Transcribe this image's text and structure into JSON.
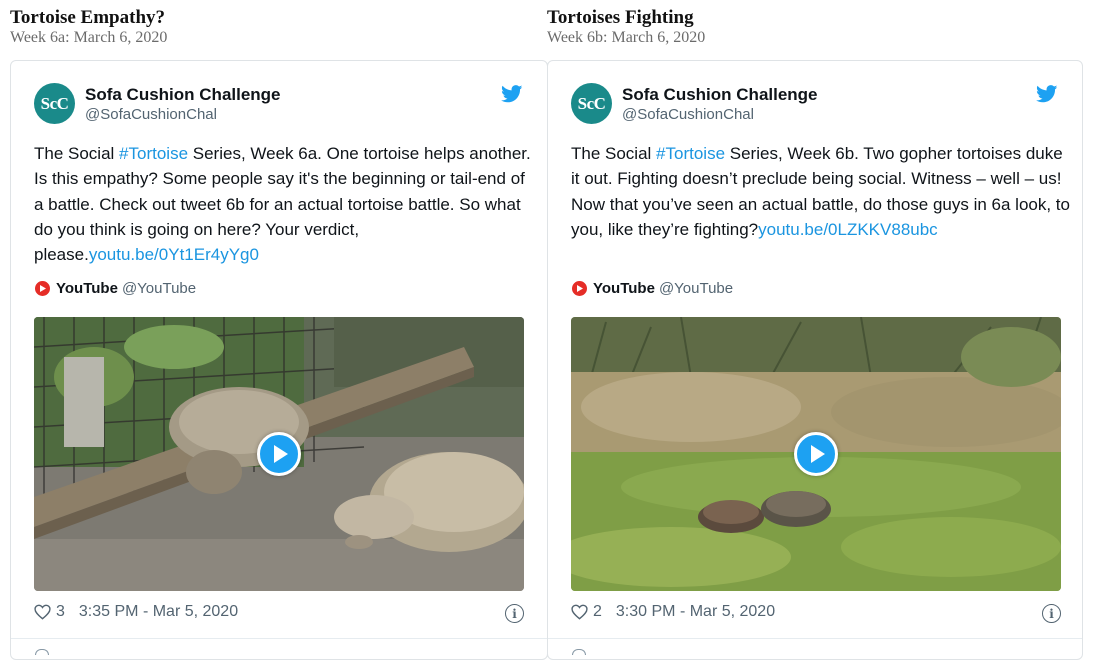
{
  "posts": [
    {
      "title": "Tortoise Empathy?",
      "subtitle": "Week 6a: March 6, 2020",
      "tweet": {
        "avatar_text": "ScC",
        "account_name": "Sofa Cushion Challenge",
        "handle": "@SofaCushionChal",
        "text_before": "The Social ",
        "hashtag": "#Tortoise",
        "text_after": " Series, Week 6a. One tortoise helps another. Is this empathy? Some people say it's the beginning or tail-end of a battle. Check out tweet 6b for an actual tortoise battle. So what do you think is going on here?  Your verdict, please.",
        "link": "youtu.be/0Yt1Er4yYg0",
        "source_name": "YouTube",
        "source_handle": "@YouTube",
        "likes": "3",
        "timestamp": "3:35 PM - Mar 5, 2020"
      }
    },
    {
      "title": "Tortoises Fighting",
      "subtitle": "Week 6b: March 6, 2020",
      "tweet": {
        "avatar_text": "ScC",
        "account_name": "Sofa Cushion Challenge",
        "handle": "@SofaCushionChal",
        "text_before": "The Social ",
        "hashtag": "#Tortoise",
        "text_after": " Series, Week 6b. Two gopher tortoises duke it out. Fighting doesn’t preclude being social. Witness – well – us! Now that you’ve seen an actual battle, do those guys in 6a look, to you, like they’re fighting?",
        "link": "youtu.be/0LZKKV88ubc",
        "source_name": "YouTube",
        "source_handle": "@YouTube",
        "likes": "2",
        "timestamp": "3:30 PM - Mar 5, 2020"
      }
    }
  ],
  "colors": {
    "link": "#1b95e0",
    "twitter_blue": "#1da1f2",
    "avatar_bg": "#1a8a8a",
    "youtube_red": "#e52d27"
  },
  "icons": [
    "twitter-bird-icon",
    "youtube-icon",
    "play-icon",
    "heart-icon",
    "info-icon"
  ]
}
